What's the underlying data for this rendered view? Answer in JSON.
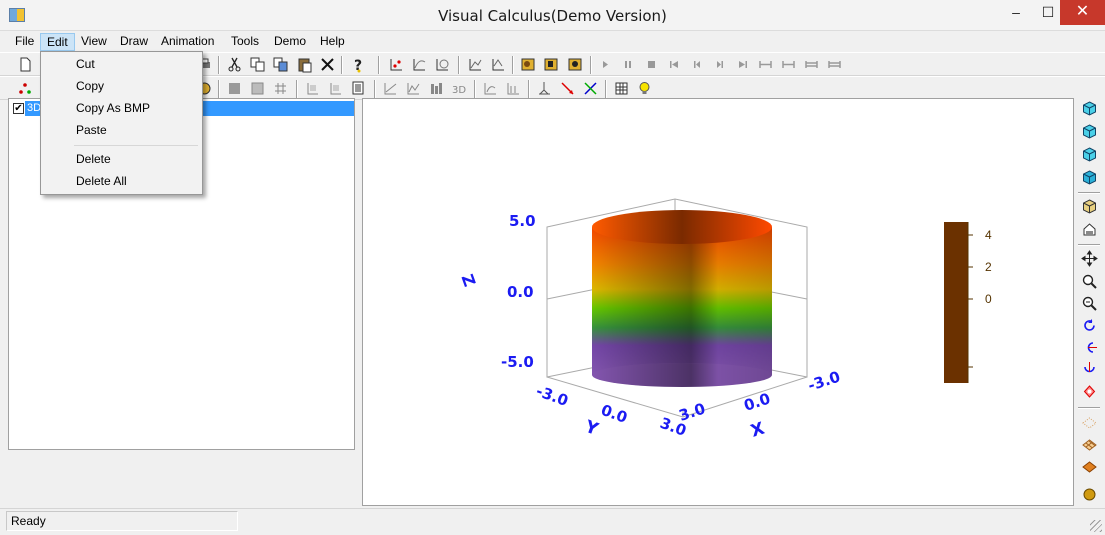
{
  "window": {
    "title": "Visual Calculus(Demo Version)",
    "min": "–",
    "max": "☐",
    "close": "✕"
  },
  "menu": [
    "File",
    "Edit",
    "View",
    "Draw",
    "Animation",
    "Tools",
    "Demo",
    "Help"
  ],
  "edit_menu": {
    "cut": "Cut",
    "copy": "Copy",
    "copy_as_bmp": "Copy As BMP",
    "paste": "Paste",
    "delete": "Delete",
    "delete_all": "Delete All"
  },
  "tree": {
    "node_label": "3D",
    "checked": "✔"
  },
  "status": {
    "text": "Ready"
  },
  "plot": {
    "axes": {
      "z_label": "Z",
      "y_label": "Y",
      "x_label": "X",
      "z_ticks": [
        "5.0",
        "0.0",
        "-5.0"
      ],
      "y_ticks": [
        "-3.0",
        "0.0",
        "3.0"
      ],
      "x_ticks": [
        "3.0",
        "0.0",
        "-3.0"
      ]
    },
    "colorbar_ticks": [
      "4",
      "2",
      "0"
    ],
    "colors": {
      "axis_text": "#1b1bf2",
      "colorbar": "#6b3100"
    }
  },
  "icons": {
    "toolbar1": [
      "new-icon",
      "cut-icon",
      "copy-icon",
      "copy-bmp-icon",
      "paste-icon",
      "delete-icon",
      "help-icon",
      "point-icon",
      "curve-icon",
      "surface-icon",
      "graph-icon",
      "graph2-icon",
      "param-icon",
      "param2-icon",
      "param3-icon",
      "play-icon",
      "pause-icon",
      "stop-icon",
      "first-icon",
      "prev-icon",
      "next-icon",
      "last-icon",
      "fit-icon",
      "fit2-icon",
      "fit3-icon",
      "fit4-icon"
    ],
    "right": [
      "view-top-icon",
      "view-front-icon",
      "view-side-icon",
      "view-iso-icon",
      "box-icon",
      "house-icon",
      "move-icon",
      "zoom-in-icon",
      "zoom-out-icon",
      "rotate-icon",
      "rotate-x-icon",
      "rotate-y-icon",
      "rotate-z-icon",
      "grid-icon",
      "mesh-icon",
      "plane-icon",
      "sphere-icon"
    ]
  }
}
